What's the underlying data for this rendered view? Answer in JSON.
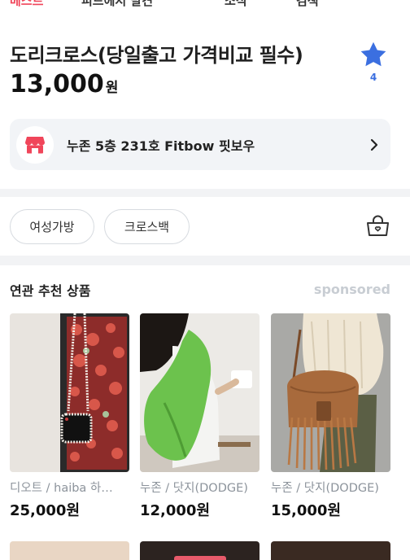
{
  "top_tabs": [
    {
      "label": "베스트",
      "active": true
    },
    {
      "label": "피드에서 발견",
      "active": false
    },
    {
      "label": "소식",
      "active": false
    },
    {
      "label": "검색",
      "active": false
    }
  ],
  "product": {
    "title": "도리크로스(당일출고 가격비교 필수)",
    "price": "13,000",
    "price_unit": "원"
  },
  "favorite": {
    "icon": "star-icon",
    "count": "4",
    "color": "#3b6fe0"
  },
  "store": {
    "icon": "store-icon",
    "name": "누존 5층 231호 Fitbow 핏보우",
    "accent": "#f0455a"
  },
  "tags": [
    "여성가방",
    "크로스백"
  ],
  "recommended": {
    "title": "연관 추천 상품",
    "sponsored_label": "sponsored",
    "items": [
      {
        "brand": "디오트 / haiba 하…",
        "price": "25,000원"
      },
      {
        "brand": "누존 / 닷지(DODGE)",
        "price": "12,000원"
      },
      {
        "brand": "누존 / 닷지(DODGE)",
        "price": "15,000원"
      }
    ]
  }
}
